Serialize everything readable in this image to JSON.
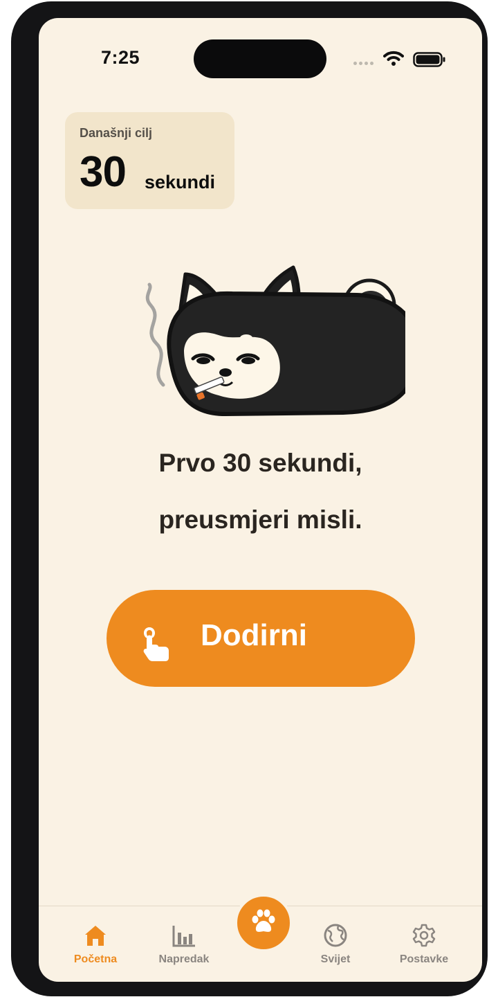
{
  "status_bar": {
    "time": "7:25"
  },
  "goal": {
    "label": "Današnji cilj",
    "value": "30",
    "unit": "sekundi"
  },
  "headline": {
    "line1": "Prvo 30 sekundi,",
    "line2": "preusmjeri misli."
  },
  "action_button": {
    "label": "Dodirni",
    "icon": "tap-hand-icon"
  },
  "tabs": [
    {
      "label": "Početna",
      "icon": "home-icon",
      "active": true
    },
    {
      "label": "Napredak",
      "icon": "bar-chart-icon",
      "active": false
    },
    {
      "label": "Svijet",
      "icon": "globe-icon",
      "active": false
    },
    {
      "label": "Postavke",
      "icon": "gear-icon",
      "active": false
    }
  ],
  "center_tab": {
    "icon": "paw-icon"
  },
  "colors": {
    "accent": "#ee8b1f",
    "background": "#faf2e4",
    "card": "#f2e5cb",
    "text": "#2a2520"
  }
}
